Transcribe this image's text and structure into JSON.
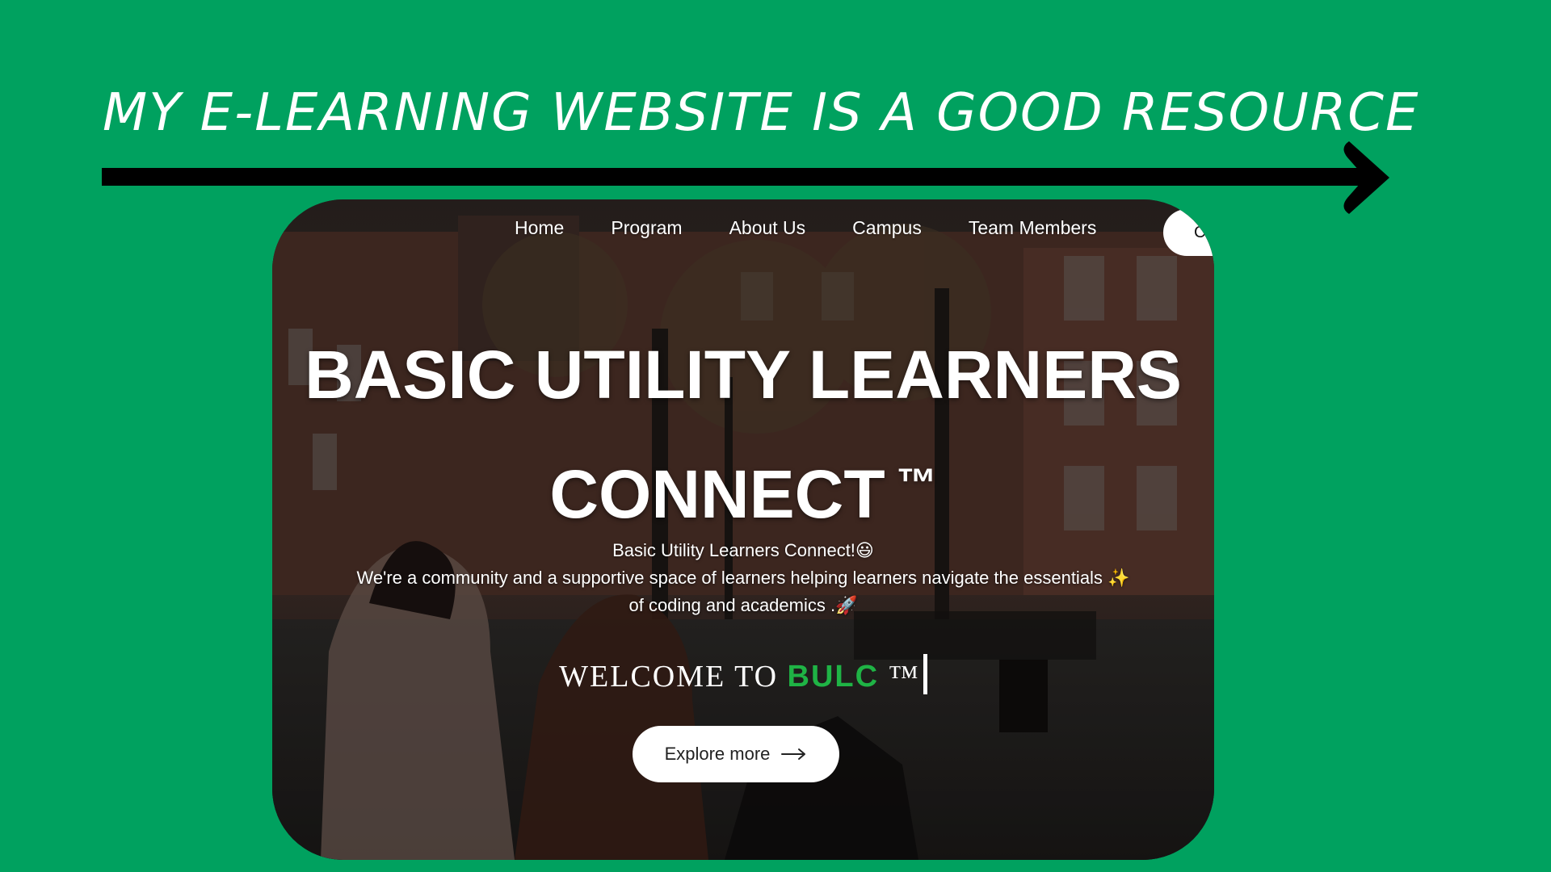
{
  "slide": {
    "headline": "MY E-LEARNING WEBSITE IS A GOOD RESOURCE"
  },
  "nav": {
    "items": [
      "Home",
      "Program",
      "About Us",
      "Campus",
      "Team Members"
    ],
    "cut_off_button_label": "C"
  },
  "hero": {
    "title_line1": "BASIC UTILITY LEARNERS",
    "title_line2": "CONNECT",
    "title_tm": "™",
    "intro_line1": "Basic Utility Learners Connect!",
    "intro_line1_emoji": "😃",
    "intro_line2": "We're a community and a supportive space of learners helping learners navigate the essentials",
    "intro_line2_emoji": "✨",
    "intro_line3": "of coding and academics .",
    "intro_line3_emoji": "🚀",
    "welcome_prefix": "WELCOME TO",
    "welcome_brand": "BULC",
    "welcome_tm": "™",
    "explore_label": "Explore more"
  },
  "colors": {
    "background": "#00a15f",
    "brand_green": "#1fb345",
    "text": "#ffffff"
  }
}
